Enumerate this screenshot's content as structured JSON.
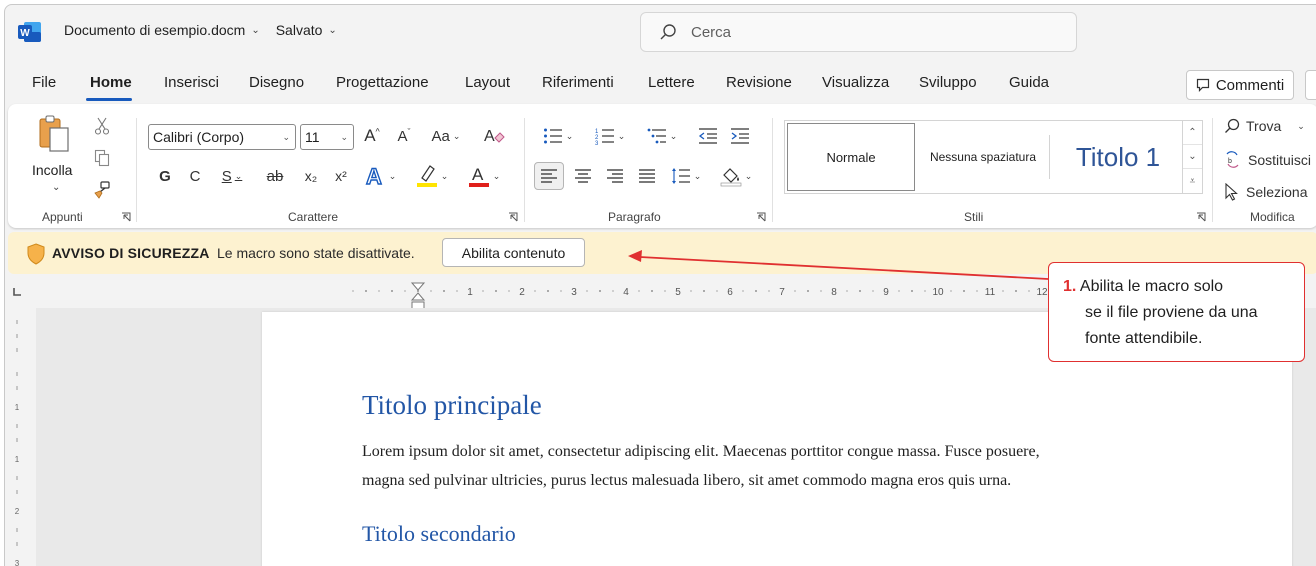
{
  "titlebar": {
    "doc_name": "Documento di esempio.docm",
    "saved": "Salvato",
    "search_placeholder": "Cerca"
  },
  "tabs": [
    "File",
    "Home",
    "Inserisci",
    "Disegno",
    "Progettazione",
    "Layout",
    "Riferimenti",
    "Lettere",
    "Revisione",
    "Visualizza",
    "Sviluppo",
    "Guida"
  ],
  "active_tab": "Home",
  "comments_label": "Commenti",
  "ribbon": {
    "groups": {
      "clipboard": "Appunti",
      "font": "Carattere",
      "paragraph": "Paragrafo",
      "styles": "Stili",
      "editing": "Modifica"
    },
    "paste_label": "Incolla",
    "font_name": "Calibri (Corpo)",
    "font_size": "11",
    "font_buttons": [
      "G",
      "C",
      "S",
      "ab",
      "x₂",
      "x²"
    ],
    "grow_font": "A^",
    "shrink_font": "Aˇ",
    "change_case": "Aa",
    "styles": [
      "Normale",
      "Nessuna spaziatura",
      "Titolo 1"
    ],
    "editing": {
      "find": "Trova",
      "replace": "Sostituisci",
      "select": "Seleziona"
    }
  },
  "security_bar": {
    "title": "AVVISO DI SICUREZZA",
    "message": "Le macro sono state disattivate.",
    "button": "Abilita contenuto"
  },
  "ruler": {
    "marks": [
      "1",
      "2",
      "3",
      "4",
      "5",
      "6",
      "7",
      "8",
      "9",
      "10",
      "11",
      "12"
    ]
  },
  "document": {
    "heading1": "Titolo principale",
    "paragraph_line1": "Lorem ipsum dolor sit amet, consectetur adipiscing elit. Maecenas porttitor congue massa. Fusce posuere,",
    "paragraph_line2": "magna sed pulvinar ultricies, purus lectus malesuada libero, sit amet commodo magna eros quis urna.",
    "heading2": "Titolo secondario"
  },
  "callout": {
    "number": "1.",
    "line1": "Abilita le macro solo",
    "line2": "se il file proviene da una",
    "line3": "fonte attendibile."
  },
  "colors": {
    "accent": "#185abd",
    "heading": "#2256a6",
    "security_bar": "#fdf2d0",
    "callout_red": "#e03030"
  }
}
